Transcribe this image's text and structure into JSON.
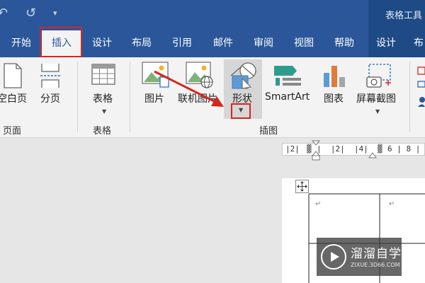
{
  "titlebar": {
    "context_group": "表格工具"
  },
  "tabs": [
    {
      "label": "开始"
    },
    {
      "label": "插入"
    },
    {
      "label": "设计"
    },
    {
      "label": "布局"
    },
    {
      "label": "引用"
    },
    {
      "label": "邮件"
    },
    {
      "label": "审阅"
    },
    {
      "label": "视图"
    },
    {
      "label": "帮助"
    },
    {
      "label": "设计"
    },
    {
      "label": "布"
    }
  ],
  "active_tab": "插入",
  "ribbon": {
    "pages": {
      "group": "页面",
      "blank_page": "空白页",
      "page_break": "分页"
    },
    "tables": {
      "group": "表格",
      "table": "表格"
    },
    "illustrations": {
      "group": "插图",
      "pictures": "图片",
      "online_pictures": "联机图片",
      "shapes": "形状",
      "smartart": "SmartArt",
      "chart": "图表",
      "screenshot": "屏幕截图"
    }
  },
  "ruler": {
    "ticks": [
      "2",
      "2",
      "4",
      "6",
      "8"
    ]
  },
  "watermark": {
    "brand": "溜溜自学",
    "url": "ZIXUE.3D66.COM"
  },
  "colors": {
    "title_bar": "#2b579a",
    "context_tab": "#1e4a86",
    "highlight_red": "#d4261e",
    "ribbon_bg": "#f3f3f3"
  }
}
